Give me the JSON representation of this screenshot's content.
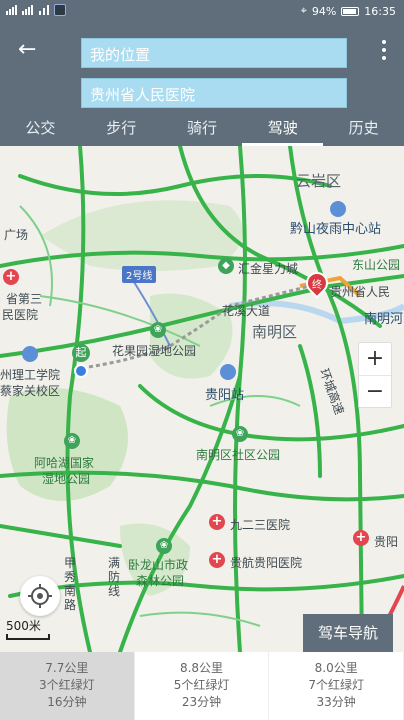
{
  "status_bar": {
    "battery": "94%",
    "time": "16:35"
  },
  "header": {
    "origin_placeholder": "我的位置",
    "destination_value": "贵州省人民医院"
  },
  "tabs": [
    {
      "label": "公交"
    },
    {
      "label": "步行"
    },
    {
      "label": "骑行"
    },
    {
      "label": "驾驶",
      "active": true
    },
    {
      "label": "历史"
    }
  ],
  "map": {
    "labels": {
      "yunyan": "云岩区",
      "qianshan": "黔山夜雨中心站",
      "dongshan": "东山公园",
      "huijin": "汇金星力城",
      "nanming": "南明区",
      "nanming_river": "南明河",
      "guizhou_hospital": "贵州省人民",
      "guizhou3": "省第三",
      "minyiyuan": "民医院",
      "guang": "广场",
      "huaxi": "花溪大道",
      "huaguoyuan": "花果园湿地公园",
      "zhouligong": "州理工学院",
      "caijia": "蔡家关校区",
      "guiyang_station": "贵阳站",
      "ahahu": "阿哈湖国家",
      "shidi": "湿地公园",
      "nanming_park": "南明区社区公园",
      "jiuersan": "九二三医院",
      "guihang": "贵航贵阳医院",
      "gui": "贵阳",
      "wolong": "卧龙山市政",
      "senlin": "森林公园",
      "jiaxiu": "甲秀南路",
      "mandong": "满防线",
      "line2": "2号线",
      "huanhuan": "环城高速",
      "start_mark": "起",
      "end_mark": "终"
    },
    "scale": "500米",
    "nav_button": "驾车导航"
  },
  "routes": [
    {
      "distance": "7.7公里",
      "lights": "3个红绿灯",
      "time": "16分钟",
      "selected": true
    },
    {
      "distance": "8.8公里",
      "lights": "5个红绿灯",
      "time": "23分钟"
    },
    {
      "distance": "8.0公里",
      "lights": "7个红绿灯",
      "time": "33分钟"
    }
  ]
}
